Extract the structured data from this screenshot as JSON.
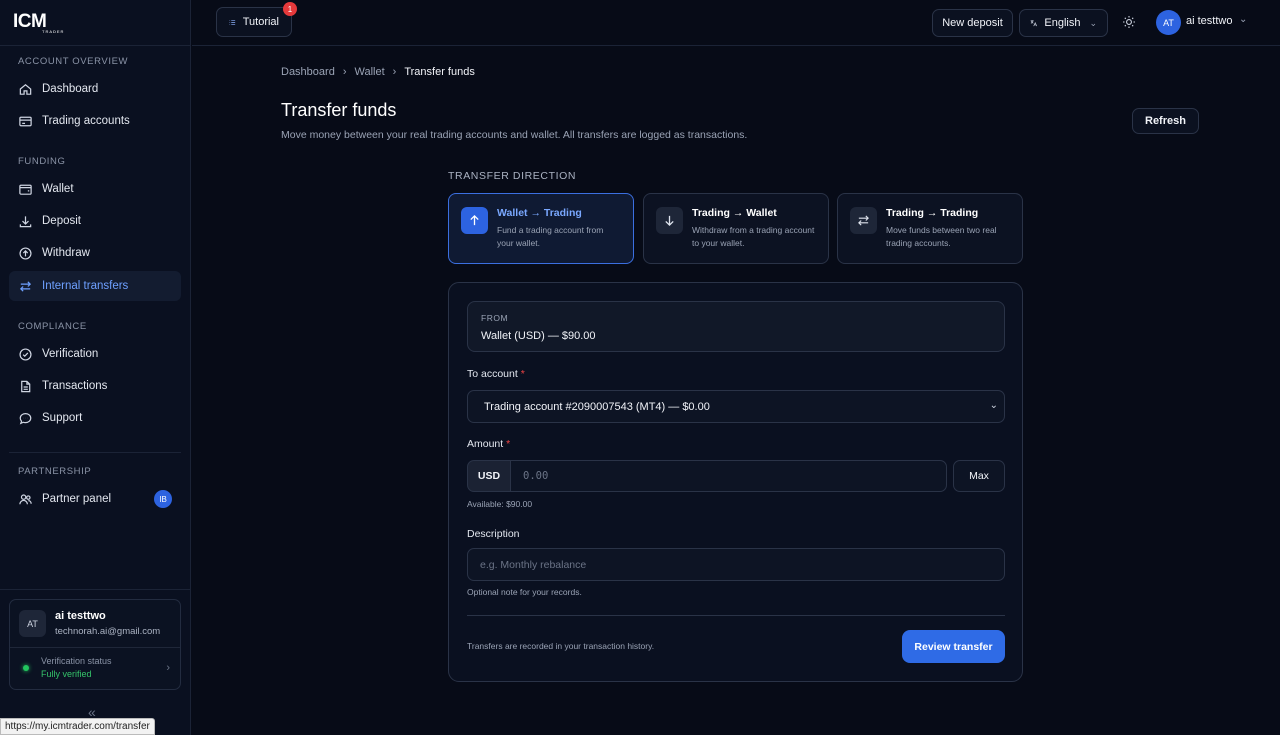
{
  "brand": {
    "logo_text": "ICM",
    "logo_sub": "TRADER"
  },
  "sidebar": {
    "sections": [
      {
        "title": "ACCOUNT OVERVIEW"
      },
      {
        "title": "FUNDING"
      },
      {
        "title": "COMPLIANCE"
      },
      {
        "title": "PARTNERSHIP"
      }
    ],
    "items": [
      {
        "label": "Dashboard",
        "icon": "home-icon"
      },
      {
        "label": "Trading accounts",
        "icon": "card-icon"
      },
      {
        "label": "Wallet",
        "icon": "wallet-icon"
      },
      {
        "label": "Deposit",
        "icon": "download-icon"
      },
      {
        "label": "Withdraw",
        "icon": "upload-icon"
      },
      {
        "label": "Internal transfers",
        "icon": "swap-icon",
        "active": true
      },
      {
        "label": "Verification",
        "icon": "check-circle-icon"
      },
      {
        "label": "Transactions",
        "icon": "document-icon"
      },
      {
        "label": "Support",
        "icon": "chat-icon"
      },
      {
        "label": "Partner panel",
        "icon": "users-icon",
        "badge": "IB"
      }
    ],
    "user": {
      "initials": "AT",
      "name": "ai testtwo",
      "email": "technorah.ai@gmail.com",
      "verification_label": "Verification status",
      "verification_value": "Fully verified"
    },
    "status_url": "https://my.icmtrader.com/transfer"
  },
  "topbar": {
    "tutorial_label": "Tutorial",
    "tutorial_badge": "1",
    "new_deposit_label": "New deposit",
    "language": "English",
    "user_initials": "AT",
    "user_name": "ai testtwo"
  },
  "breadcrumb": [
    "Dashboard",
    "Wallet",
    "Transfer funds"
  ],
  "page": {
    "title": "Transfer funds",
    "subtitle": "Move money between your real trading accounts and wallet. All transfers are logged as transactions.",
    "refresh_label": "Refresh"
  },
  "direction": {
    "title": "TRANSFER DIRECTION",
    "options": [
      {
        "name": "Wallet → Trading",
        "desc": "Fund a trading account from your wallet.",
        "icon": "arrow-up-icon",
        "active": true
      },
      {
        "name": "Trading → Wallet",
        "desc": "Withdraw from a trading account to your wallet.",
        "icon": "arrow-down-icon"
      },
      {
        "name": "Trading → Trading",
        "desc": "Move funds between two real trading accounts.",
        "icon": "swap-icon"
      }
    ]
  },
  "form": {
    "from_label": "FROM",
    "from_value": "Wallet (USD) — $90.00",
    "to_label": "To account",
    "required_mark": "*",
    "to_value": "Trading account #2090007543 (MT4) — $0.00",
    "amount_label": "Amount",
    "currency": "USD",
    "amount_placeholder": "0.00",
    "max_label": "Max",
    "available": "Available: $90.00",
    "description_label": "Description",
    "description_placeholder": "e.g. Monthly rebalance",
    "description_hint": "Optional note for your records.",
    "footer_note": "Transfers are recorded in your transaction history.",
    "review_label": "Review transfer"
  },
  "colors": {
    "accent": "#2f6be6",
    "background": "#070b17",
    "verified": "#22c55e",
    "badge": "#e5393b"
  }
}
